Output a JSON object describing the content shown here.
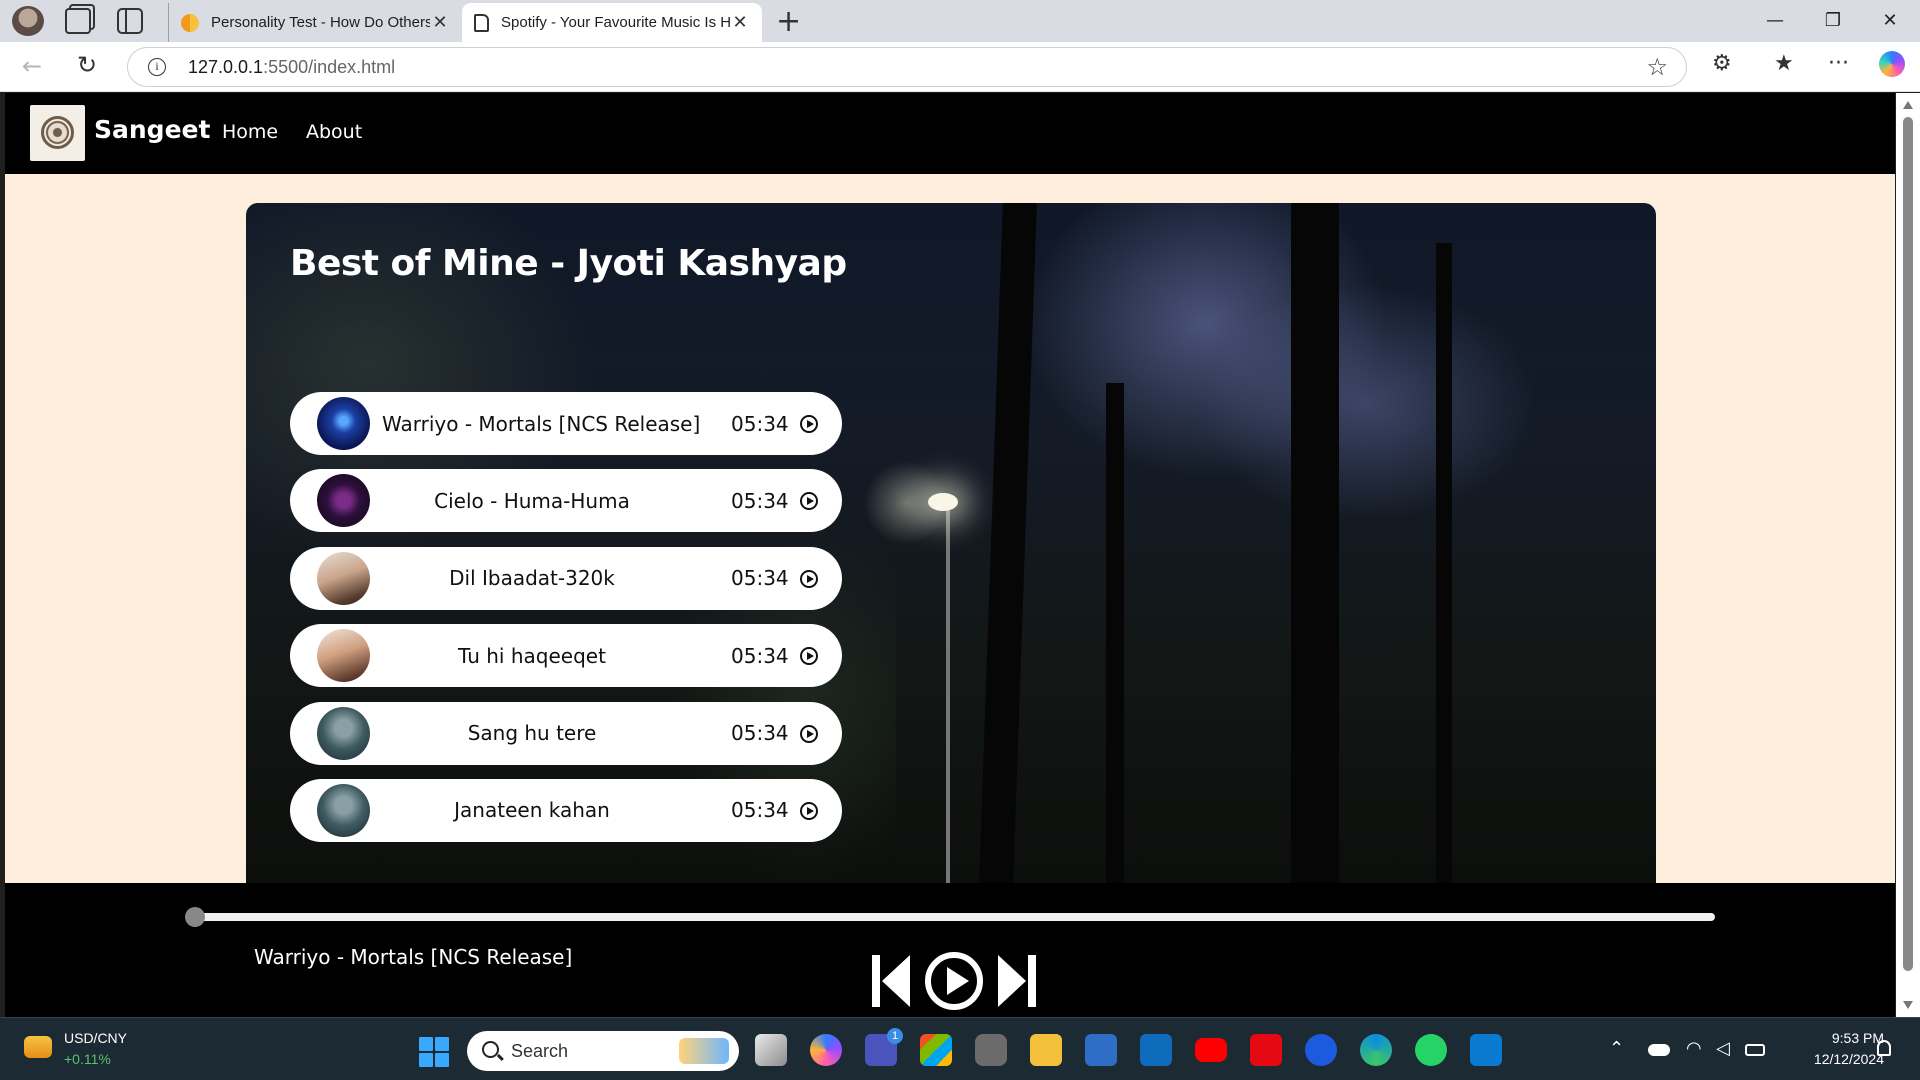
{
  "browser": {
    "tabs": [
      {
        "title": "Personality Test - How Do Others See You?",
        "active": false
      },
      {
        "title": "Spotify - Your Favourite Music Is Here",
        "active": true
      }
    ],
    "close_glyph": "✕",
    "new_tab_glyph": "+",
    "url_host": "127.0.0.1",
    "url_path": ":5500/index.html",
    "window_controls": {
      "minimize": "—",
      "restore": "❐",
      "close": "✕"
    },
    "icons": {
      "back": "←",
      "reload": "↻",
      "info": "i",
      "favorite": "☆",
      "extensions": "⚙",
      "favorites_list": "★",
      "more": "···"
    }
  },
  "navbar": {
    "brand": "Sangeet",
    "links": [
      "Home",
      "About"
    ]
  },
  "playlist": {
    "title": "Best of Mine - Jyoti Kashyap",
    "songs": [
      {
        "name": "Warriyo - Mortals [NCS Release]",
        "duration": "05:34",
        "cover": "cover-1"
      },
      {
        "name": "Cielo - Huma-Huma",
        "duration": "05:34",
        "cover": "cover-2"
      },
      {
        "name": "Dil Ibaadat-320k",
        "duration": "05:34",
        "cover": "cover-3"
      },
      {
        "name": "Tu hi haqeeqet",
        "duration": "05:34",
        "cover": "cover-4"
      },
      {
        "name": "Sang hu tere",
        "duration": "05:34",
        "cover": "cover-5"
      },
      {
        "name": "Janateen kahan",
        "duration": "05:34",
        "cover": "cover-6"
      }
    ]
  },
  "player": {
    "now_playing": "Warriyo - Mortals [NCS Release]",
    "progress": 0,
    "state": "paused"
  },
  "colors": {
    "page_bg": "#fdeedd",
    "navbar_bg": "#000000",
    "accent_white": "#ffffff"
  },
  "taskbar": {
    "widget_name": "USD/CNY",
    "widget_change": "+0.11%",
    "search_placeholder": "Search",
    "teams_badge": "1",
    "time": "9:53 PM",
    "date": "12/12/2024"
  }
}
